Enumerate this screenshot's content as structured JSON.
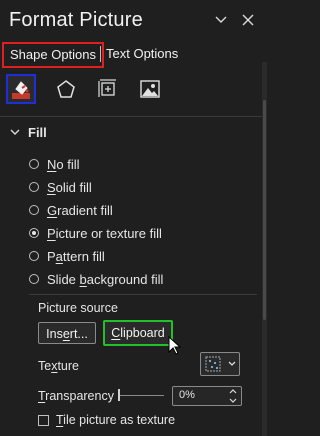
{
  "pane": {
    "title": "Format Picture"
  },
  "tabs": [
    {
      "label": "Shape Options"
    },
    {
      "label": "Text Options"
    }
  ],
  "icons": [
    {
      "name": "fill-line-icon",
      "selected": true
    },
    {
      "name": "effects-icon"
    },
    {
      "name": "size-properties-icon"
    },
    {
      "name": "picture-icon"
    }
  ],
  "fill": {
    "header": "Fill",
    "options": [
      {
        "label": "No fill",
        "ul": "N",
        "rest": "o fill",
        "selected": false
      },
      {
        "label": "Solid fill",
        "ul": "S",
        "rest": "olid fill",
        "selected": false
      },
      {
        "label": "Gradient fill",
        "ul": "G",
        "rest": "radient fill",
        "selected": false
      },
      {
        "label": "Picture or texture fill",
        "ul": "P",
        "rest": "icture or texture fill",
        "selected": true
      },
      {
        "label": "Pattern fill",
        "pre": "P",
        "ul": "a",
        "rest": "ttern fill",
        "selected": false
      },
      {
        "label": "Slide background fill",
        "pre": "Slide ",
        "ul": "b",
        "rest": "ackground fill",
        "selected": false
      }
    ],
    "picture_source_label": "Picture source",
    "insert_btn": {
      "pre": "Ins",
      "ul": "e",
      "rest": "rt..."
    },
    "clipboard_btn": {
      "ul": "C",
      "rest": "lipboard"
    },
    "texture_label": {
      "pre": "Te",
      "ul": "x",
      "rest": "ture"
    },
    "transparency_label": {
      "ul": "T",
      "rest": "ransparency"
    },
    "transparency_value": "0%",
    "transparency_fraction": 0,
    "tile_label": {
      "ul": "T",
      "rest": "ile picture as texture"
    }
  },
  "colors": {
    "background": "#1f1f1f",
    "selected_tab_outline": "#e02020",
    "selected_icon_outline": "#1f2fd8",
    "clipboard_outline": "#22c12a"
  }
}
